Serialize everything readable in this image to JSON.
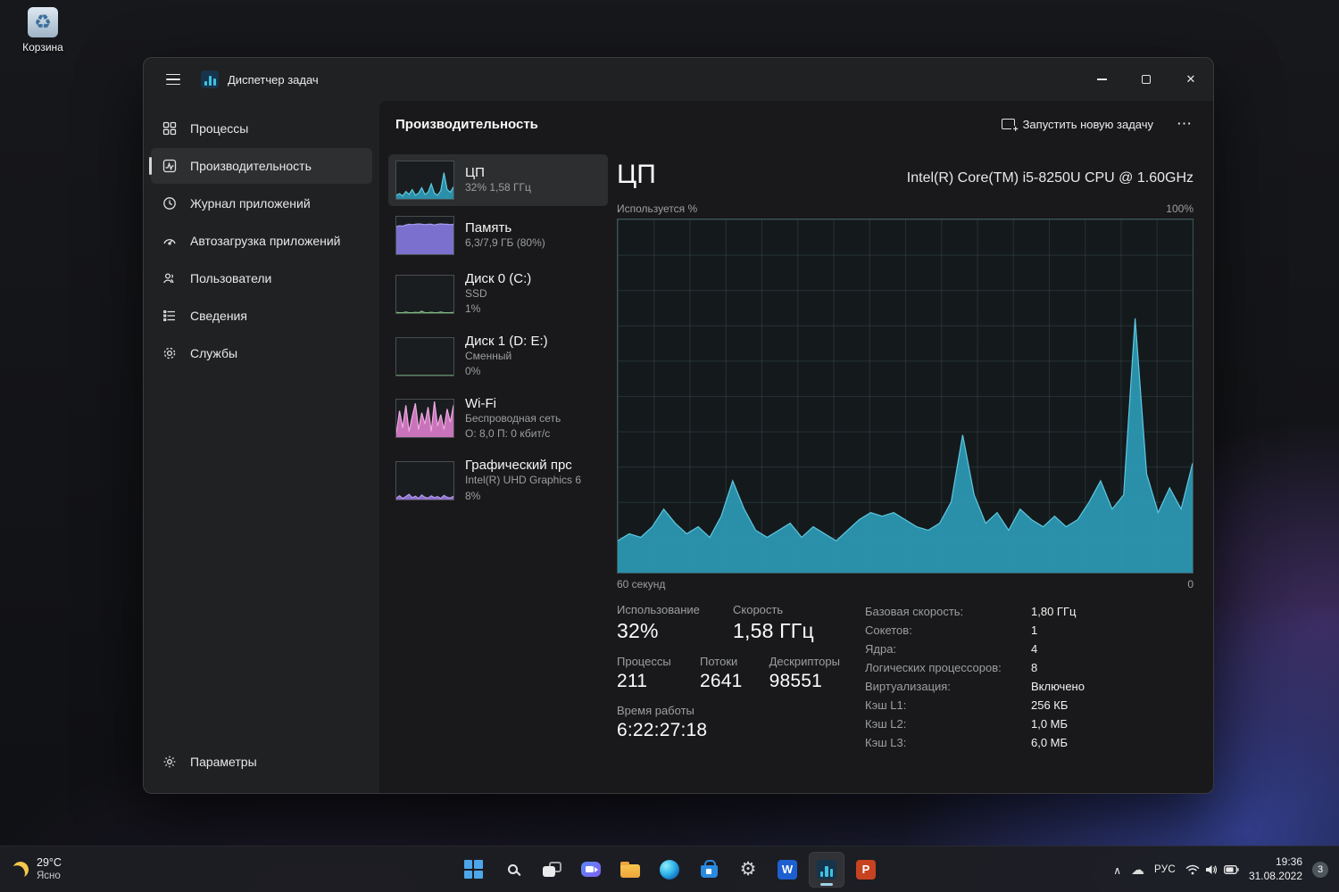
{
  "icons": {
    "recycle": "♻",
    "close": "✕",
    "more": "⋯",
    "chevron_up": "∧",
    "cloud": "☁",
    "word": "W",
    "ppt": "P"
  },
  "desktop": {
    "recycle_bin_label": "Корзина"
  },
  "window": {
    "title": "Диспетчер задач",
    "sidebar": {
      "items": [
        {
          "label": "Процессы"
        },
        {
          "label": "Производительность"
        },
        {
          "label": "Журнал приложений"
        },
        {
          "label": "Автозагрузка приложений"
        },
        {
          "label": "Пользователи"
        },
        {
          "label": "Сведения"
        },
        {
          "label": "Службы"
        }
      ],
      "settings_label": "Параметры"
    },
    "toolbar": {
      "page_title": "Производительность",
      "run_new_task_label": "Запустить новую задачу"
    },
    "perf_list": [
      {
        "title": "ЦП",
        "line1": "32% 1,58 ГГц",
        "line2": "",
        "spark": [
          10,
          14,
          8,
          20,
          12,
          25,
          10,
          15,
          30,
          12,
          18,
          40,
          15,
          10,
          22,
          70,
          25,
          18,
          32
        ]
      },
      {
        "title": "Память",
        "line1": "6,3/7,9 ГБ (80%)",
        "line2": "",
        "spark": [
          74,
          76,
          75,
          78,
          80,
          79,
          80,
          81,
          80,
          79,
          80,
          80,
          78,
          80,
          81,
          80,
          80,
          79,
          80
        ]
      },
      {
        "title": "Диск 0 (C:)",
        "line1": "SSD",
        "line2": "1%",
        "spark": [
          2,
          1,
          1,
          3,
          1,
          1,
          2,
          1,
          5,
          1,
          1,
          2,
          1,
          1,
          3,
          1,
          1,
          1,
          2
        ]
      },
      {
        "title": "Диск 1 (D: E:)",
        "line1": "Сменный",
        "line2": "0%",
        "spark": [
          0,
          0,
          0,
          0,
          0,
          0,
          0,
          0,
          0,
          0,
          0,
          0,
          0,
          0,
          0,
          0,
          0,
          0,
          0
        ]
      },
      {
        "title": "Wi-Fi",
        "line1": "Беспроводная сеть",
        "line2": "О: 8,0 П: 0 кбит/с",
        "spark": [
          10,
          70,
          25,
          85,
          15,
          55,
          90,
          20,
          65,
          35,
          80,
          15,
          95,
          30,
          60,
          20,
          75,
          40,
          85
        ]
      },
      {
        "title": "Графический прс",
        "line1": "Intel(R) UHD Graphics 6",
        "line2": "8%",
        "spark": [
          4,
          10,
          3,
          8,
          14,
          5,
          9,
          3,
          12,
          6,
          4,
          10,
          5,
          8,
          3,
          11,
          6,
          4,
          9
        ]
      }
    ],
    "cpu": {
      "title": "ЦП",
      "subtitle": "Intel(R) Core(TM) i5-8250U CPU @ 1.60GHz",
      "chart_top_left": "Используется %",
      "chart_top_right": "100%",
      "chart_bottom_left": "60 секунд",
      "chart_bottom_right": "0",
      "stats": {
        "usage_label": "Использование",
        "usage": "32%",
        "speed_label": "Скорость",
        "speed": "1,58 ГГц",
        "processes_label": "Процессы",
        "processes": "211",
        "threads_label": "Потоки",
        "threads": "2641",
        "handles_label": "Дескрипторы",
        "handles": "98551",
        "uptime_label": "Время работы",
        "uptime": "6:22:27:18"
      },
      "details": [
        {
          "label": "Базовая скорость:",
          "value": "1,80 ГГц"
        },
        {
          "label": "Сокетов:",
          "value": "1"
        },
        {
          "label": "Ядра:",
          "value": "4"
        },
        {
          "label": "Логических процессоров:",
          "value": "8"
        },
        {
          "label": "Виртуализация:",
          "value": "Включено"
        },
        {
          "label": "Кэш L1:",
          "value": "256 КБ"
        },
        {
          "label": "Кэш L2:",
          "value": "1,0 МБ"
        },
        {
          "label": "Кэш L3:",
          "value": "6,0 МБ"
        }
      ]
    }
  },
  "chart_data": {
    "type": "area",
    "title": "ЦП — Используется %",
    "xlabel": "60 секунд → 0",
    "ylabel": "Используется %",
    "ylim": [
      0,
      100
    ],
    "x_range_seconds": [
      60,
      0
    ],
    "grid": true,
    "values": [
      9,
      11,
      10,
      13,
      18,
      14,
      11,
      13,
      10,
      16,
      26,
      18,
      12,
      10,
      12,
      14,
      10,
      13,
      11,
      9,
      12,
      15,
      17,
      16,
      17,
      15,
      13,
      12,
      14,
      20,
      39,
      22,
      14,
      17,
      12,
      18,
      15,
      13,
      16,
      13,
      15,
      20,
      26,
      18,
      22,
      72,
      28,
      17,
      24,
      18,
      31
    ]
  },
  "colors": {
    "cpu_fill": "#2D9FBD",
    "cpu_stroke": "#5FC8E0",
    "mem_fill": "#8A7CE8",
    "mem_stroke": "#A89BF0",
    "disk_fill": "#5E9B5E",
    "disk_stroke": "#7FBF7F",
    "wifi_fill": "#E07FD0",
    "wifi_stroke": "#F0A8E2",
    "gpu_fill": "#9B7BE0",
    "gpu_stroke": "#B79BEF"
  },
  "taskbar": {
    "weather": {
      "temp": "29°C",
      "condition": "Ясно"
    },
    "tray": {
      "language": "РУС",
      "time": "19:36",
      "date": "31.08.2022",
      "badge": "3"
    }
  }
}
